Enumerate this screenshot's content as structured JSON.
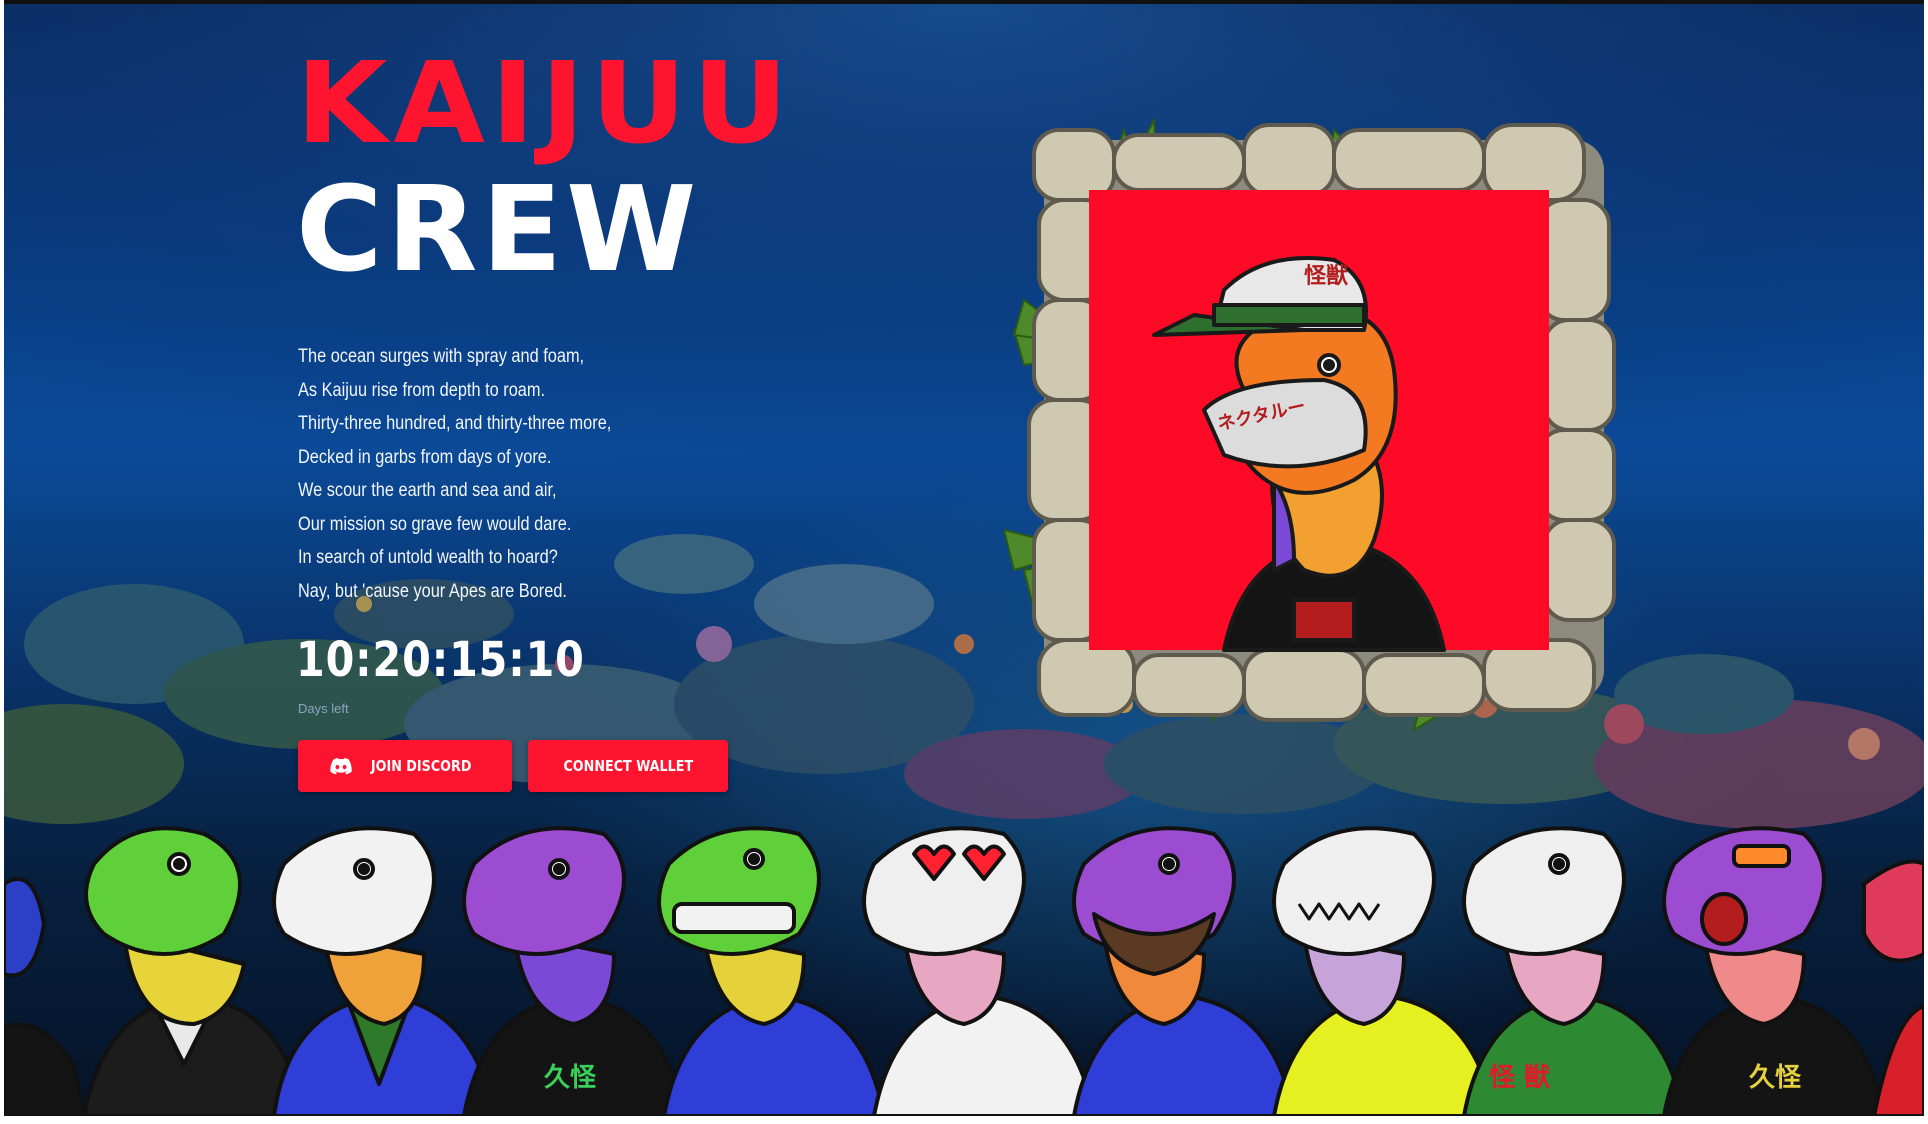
{
  "hero": {
    "title_line1": "KAIJUU",
    "title_line2": "CREW",
    "poem": [
      "The ocean surges with spray and foam,",
      "As Kaijuu rise from depth to roam.",
      "Thirty-three hundred, and thirty-three more,",
      "Decked in garbs from days of yore.",
      "We scour the earth and sea and air,",
      "Our mission so grave few would dare.",
      "In search of untold wealth to hoard?",
      "Nay, but 'cause your Apes are Bored."
    ],
    "countdown": "10:20:15:10",
    "countdown_label": "Days left"
  },
  "buttons": {
    "discord": "JOIN DISCORD",
    "wallet": "CONNECT WALLET"
  },
  "icons": {
    "discord": "discord-icon"
  },
  "colors": {
    "accent_red": "#ff1430",
    "ocean_deep": "#07203f",
    "ocean_mid": "#0b4a98",
    "text_white": "#ffffff"
  },
  "featured_art": {
    "cap_kanji": "怪獣",
    "mask_katakana": "ネクタルー"
  },
  "lineup": {
    "shirt_texts": [
      "久怪",
      "久怪",
      "怪 獣",
      "久怪"
    ]
  }
}
